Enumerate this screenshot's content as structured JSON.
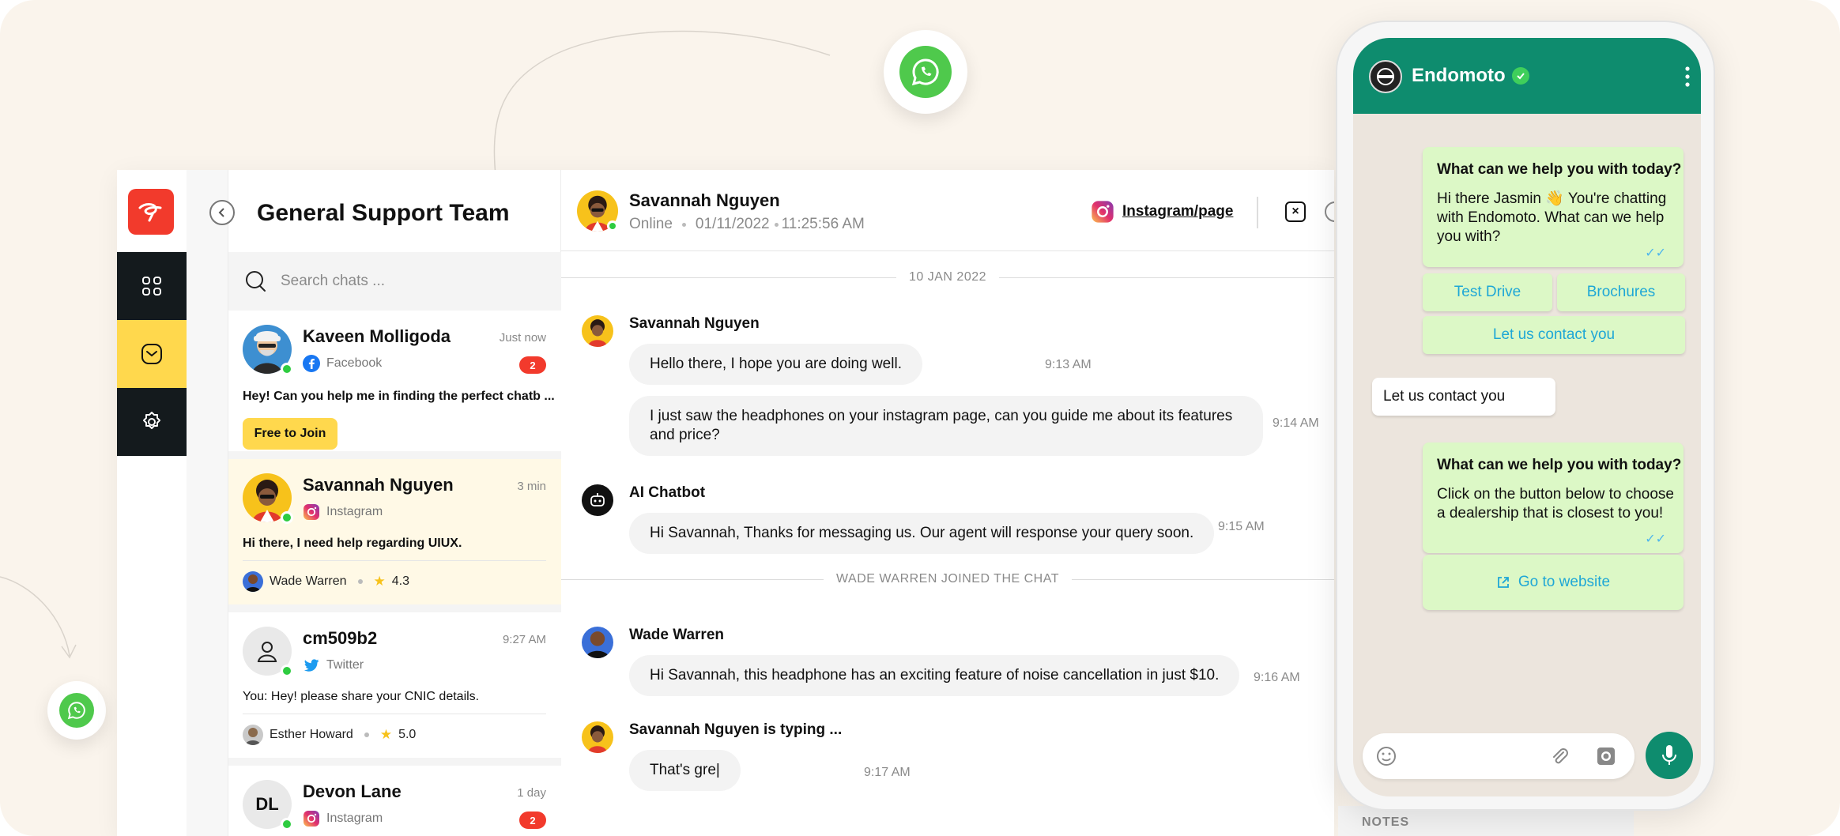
{
  "colors": {
    "brand": "#f23a2c",
    "accent": "#ffd84d",
    "nav_dark": "#141a1d",
    "whatsapp": "#0e8c6e",
    "online": "#2ecc40"
  },
  "sidebar": {
    "items": [
      {
        "icon": "grid-icon",
        "active": false
      },
      {
        "icon": "inbox-icon",
        "active": true
      },
      {
        "icon": "gear-icon",
        "active": false
      }
    ]
  },
  "list": {
    "title": "General Support Team",
    "search_placeholder": "Search chats ...",
    "chats": [
      {
        "name": "Kaveen Molligoda",
        "time": "Just now",
        "source": "Facebook",
        "badge": "2",
        "message": "Hey! Can you help me in finding the perfect chatb ...",
        "button": "Free to Join"
      },
      {
        "name": "Savannah Nguyen",
        "time": "3 min",
        "source": "Instagram",
        "message": "Hi there, I need help regarding UIUX.",
        "agent": "Wade Warren",
        "rating": "4.3"
      },
      {
        "name": "cm509b2",
        "time": "9:27 AM",
        "source": "Twitter",
        "message": "You: Hey! please share your CNIC details.",
        "agent": "Esther Howard",
        "rating": "5.0"
      },
      {
        "name": "Devon Lane",
        "time": "1 day",
        "source": "Instagram",
        "badge": "2",
        "initials": "DL"
      }
    ]
  },
  "conversation": {
    "header": {
      "name": "Savannah Nguyen",
      "status": "Online",
      "date": "01/11/2022",
      "time": "11:25:56 AM",
      "link": "Instagram/page"
    },
    "date_separator": "10 JAN 2022",
    "join_separator": "WADE WARREN JOINED THE CHAT",
    "messages": [
      {
        "sender": "Savannah Nguyen",
        "text": "Hello there, I hope you are doing well.",
        "time": "9:13 AM"
      },
      {
        "text": "I just saw the headphones on your instagram page, can you guide me about its features and price?",
        "time": "9:14 AM"
      },
      {
        "sender": "AI Chatbot",
        "text": "Hi Savannah, Thanks for messaging us. Our agent will response your query soon.",
        "time": "9:15 AM"
      },
      {
        "sender": "Wade Warren",
        "text": "Hi Savannah, this headphone has an exciting feature of noise cancellation in just $10.",
        "time": "9:16 AM"
      },
      {
        "sender": "Savannah Nguyen is typing ...",
        "text": "That's gre|",
        "time": "9:17 AM"
      }
    ]
  },
  "notes": {
    "label": "NOTES"
  },
  "phone": {
    "contact": "Endomoto",
    "card1": {
      "title": "What can we help you with today?",
      "body": "Hi there Jasmin 👋 You're chatting with Endomoto. What can we help you with?"
    },
    "buttons": [
      "Test Drive",
      "Brochures",
      "Let us contact you"
    ],
    "incoming": "Let us contact you",
    "card2": {
      "title": "What can we help you with today?",
      "body": "Click on the button below to choose a dealership that is closest to you!",
      "link": "Go to website"
    }
  }
}
